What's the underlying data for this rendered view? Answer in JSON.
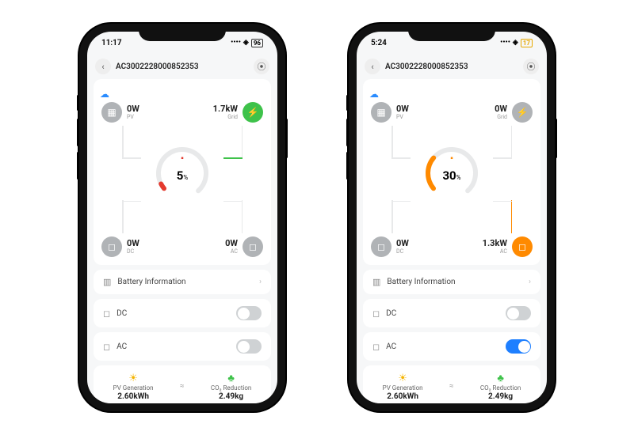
{
  "phones": [
    {
      "status": {
        "time": "11:17",
        "battery": "96",
        "battery_low": false
      },
      "header": {
        "title": "AC300222800085235​3"
      },
      "nodes": {
        "pv": {
          "value": "0W",
          "label": "PV",
          "color": "grey"
        },
        "grid": {
          "value": "1.7kW",
          "label": "Grid",
          "color": "green"
        },
        "dc": {
          "value": "0W",
          "label": "DC",
          "color": "grey"
        },
        "ac": {
          "value": "0W",
          "label": "AC",
          "color": "grey"
        }
      },
      "gauge": {
        "percent": "5",
        "color": "#e43a2e",
        "battery_icon_color": "#e43a2e"
      },
      "rows": {
        "battery_info": "Battery Information",
        "dc_label": "DC",
        "dc_on": false,
        "ac_label": "AC",
        "ac_on": false
      },
      "footer": {
        "pv_label": "PV Generation",
        "pv_value": "2.60kWh",
        "co2_label": "CO₂ Reduction",
        "co2_value": "2.49kg"
      }
    },
    {
      "status": {
        "time": "5:24",
        "battery": "17",
        "battery_low": true
      },
      "header": {
        "title": "AC300222800085235​3"
      },
      "nodes": {
        "pv": {
          "value": "0W",
          "label": "PV",
          "color": "grey"
        },
        "grid": {
          "value": "0W",
          "label": "Grid",
          "color": "grey"
        },
        "dc": {
          "value": "0W",
          "label": "DC",
          "color": "grey"
        },
        "ac": {
          "value": "1.3kW",
          "label": "AC",
          "color": "orange"
        }
      },
      "gauge": {
        "percent": "30",
        "color": "#ff8a00",
        "battery_icon_color": "#ff8a00"
      },
      "rows": {
        "battery_info": "Battery Information",
        "dc_label": "DC",
        "dc_on": false,
        "ac_label": "AC",
        "ac_on": true
      },
      "footer": {
        "pv_label": "PV Generation",
        "pv_value": "2.60kWh",
        "co2_label": "CO₂ Reduction",
        "co2_value": "2.49kg"
      }
    }
  ]
}
